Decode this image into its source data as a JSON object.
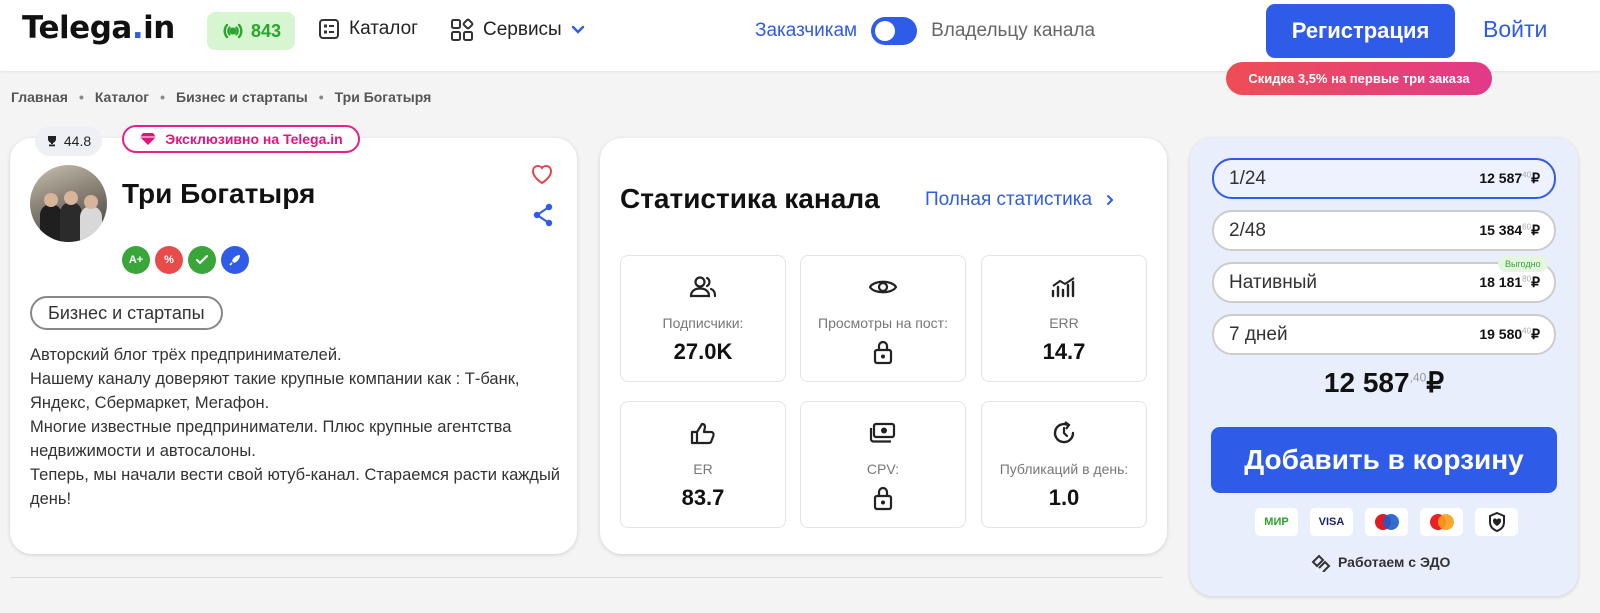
{
  "header": {
    "logo_main": "Telega",
    "logo_dot": ".",
    "logo_tail": "in",
    "online_count": "843",
    "catalog_label": "Каталог",
    "services_label": "Сервисы",
    "role_customers": "Заказчикам",
    "role_owners": "Владельцу канала",
    "register_label": "Регистрация",
    "login_label": "Войти",
    "promo": "Скидка 3,5% на первые три заказа",
    "accent_color": "#2f5be9"
  },
  "breadcrumb": [
    "Главная",
    "Каталог",
    "Бизнес и стартапы",
    "Три Богатыря"
  ],
  "channel": {
    "rating": "44.8",
    "exclusive": "Эксклюзивно на Telega.in",
    "name": "Три Богатыря",
    "badges": [
      {
        "icon": "a-plus-badge",
        "text": "A+",
        "color": "#3aa63a"
      },
      {
        "icon": "percent-badge",
        "text": "%",
        "color": "#e94b4b"
      },
      {
        "icon": "handshake-badge",
        "text": "",
        "color": "#3aa63a"
      },
      {
        "icon": "rocket-badge",
        "text": "",
        "color": "#2f5be9"
      }
    ],
    "category": "Бизнес и стартапы",
    "description": "Авторский блог трёх предпринимателей.\nНашему каналу доверяют такие крупные компании как : Т-банк, Яндекс, Сбермаркет, Мегафон.\nМногие известные предприниматели. Плюс крупные агентства недвижимости и автосалоны.\nТеперь, мы начали вести свой ютуб-канал. Стараемся расти каждый день!"
  },
  "stats": {
    "title": "Статистика канала",
    "full_link": "Полная статистика",
    "items": [
      {
        "icon": "subscribers-icon",
        "label": "Подписчики:",
        "value": "27.0K"
      },
      {
        "icon": "eye-icon",
        "label": "Просмотры на пост:",
        "value": ""
      },
      {
        "icon": "err-chart-icon",
        "label": "ERR",
        "value": "14.7"
      },
      {
        "icon": "thumb-up-icon",
        "label": "ER",
        "value": "83.7"
      },
      {
        "icon": "money-icon",
        "label": "CPV:",
        "value": ""
      },
      {
        "icon": "clock-refresh-icon",
        "label": "Публикаций в день:",
        "value": "1.0"
      }
    ]
  },
  "order": {
    "options": [
      {
        "name": "1/24",
        "price": "12 587",
        "kop": "40",
        "currency": "₽",
        "selected": true
      },
      {
        "name": "2/48",
        "price": "15 384",
        "kop": "60",
        "currency": "₽",
        "selected": false
      },
      {
        "name": "Нативный",
        "price": "18 181",
        "kop": "80",
        "currency": "₽",
        "selected": false
      },
      {
        "name": "7 дней",
        "price": "19 580",
        "kop": "40",
        "currency": "₽",
        "selected": false
      }
    ],
    "benefit_label": "Выгодно",
    "total_main": "12 587",
    "total_kop": ",40",
    "total_currency": "₽",
    "cart_label": "Добавить в корзину",
    "payments": [
      "МИР",
      "VISA",
      "maestro-icon",
      "mastercard-icon",
      "shield-icon"
    ],
    "edo_label": "Работаем с ЭДО"
  }
}
